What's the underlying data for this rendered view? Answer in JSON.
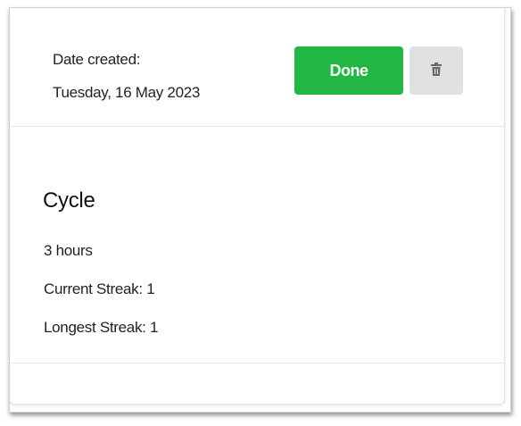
{
  "task_card": {
    "date_created_label": "Date created:",
    "date_created_value": "Tuesday, 16 May 2023",
    "done_button_label": "Done",
    "delete_icon": "trash-icon",
    "habit": {
      "title": "Cycle",
      "duration": "3 hours",
      "current_streak": "Current Streak: 1",
      "longest_streak": "Longest Streak: 1"
    }
  },
  "colors": {
    "done_button": "#22b745",
    "delete_button": "#e1e1e1",
    "trash_icon": "#666666"
  }
}
